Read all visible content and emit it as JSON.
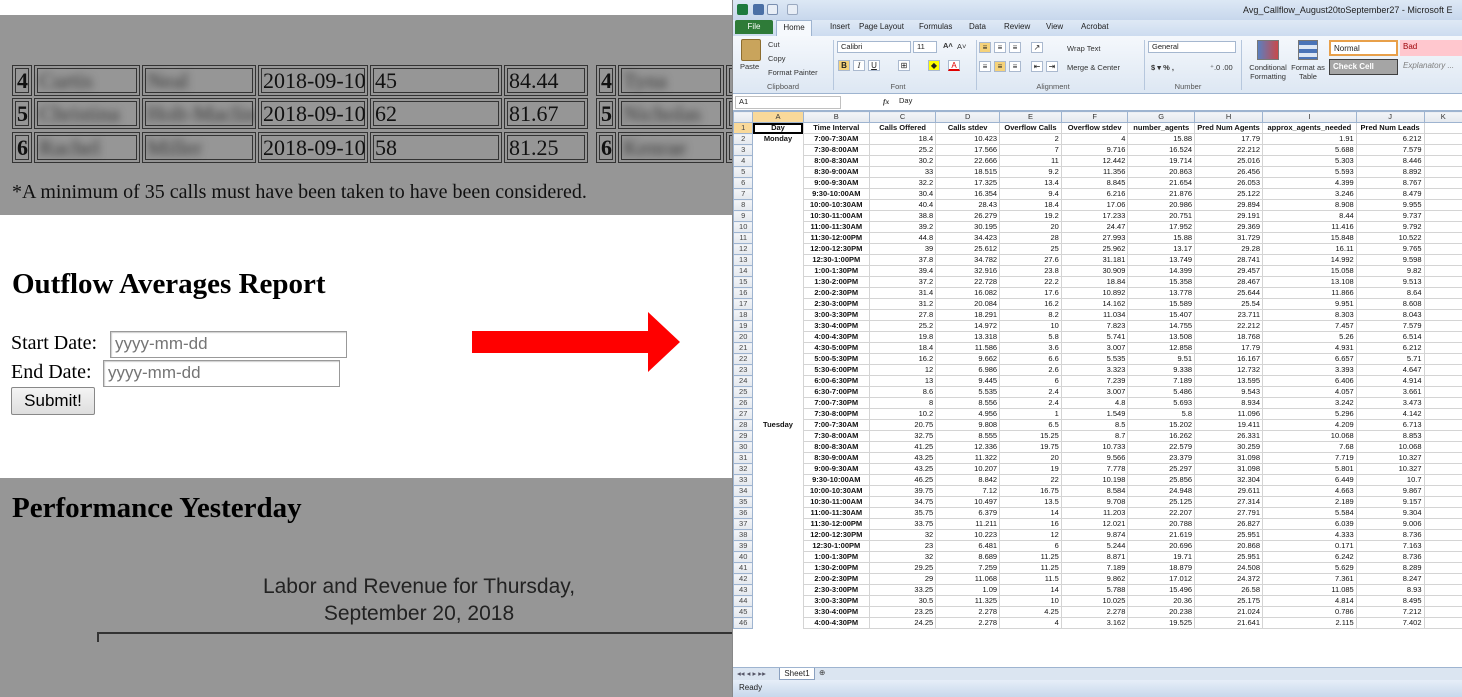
{
  "web": {
    "top_rows": [
      {
        "rank": "4",
        "first": "Curtis",
        "last": "Neal",
        "date": "2018-09-10",
        "calls": "45",
        "score": "84.44",
        "rank2": "4",
        "first2": "Tyna"
      },
      {
        "rank": "5",
        "first": "Christina",
        "last": "Holt-Maclin",
        "date": "2018-09-10",
        "calls": "62",
        "score": "81.67",
        "rank2": "5",
        "first2": "Nicholas"
      },
      {
        "rank": "6",
        "first": "Rachel",
        "last": "Miller",
        "date": "2018-09-10",
        "calls": "58",
        "score": "81.25",
        "rank2": "6",
        "first2": "Kenrae"
      }
    ],
    "note": "*A minimum of 35 calls must have been taken to have been considered.",
    "report_title": "Outflow Averages Report",
    "start_label": "Start Date:",
    "start_placeholder": "yyyy-mm-dd",
    "end_label": "End Date:",
    "end_placeholder": "yyyy-mm-dd",
    "submit_label": "Submit!",
    "perf_title": "Performance Yesterday",
    "labor_line1": "Labor and Revenue for Thursday,",
    "labor_line2": "September 20, 2018",
    "arrow_color": "#ff0000"
  },
  "excel": {
    "window_title": "Avg_Callflow_August20toSeptember27 - Microsoft E",
    "tabs": [
      "File",
      "Home",
      "Insert",
      "Page Layout",
      "Formulas",
      "Data",
      "Review",
      "View",
      "Acrobat"
    ],
    "clipboard": {
      "paste": "Paste",
      "cut": "Cut",
      "copy": "Copy",
      "format_painter": "Format Painter",
      "group": "Clipboard"
    },
    "font": {
      "name": "Calibri",
      "size": "11",
      "group": "Font"
    },
    "alignment": {
      "wrap": "Wrap Text",
      "merge": "Merge & Center",
      "group": "Alignment"
    },
    "number": {
      "format": "General",
      "group": "Number"
    },
    "styles": {
      "conditional": "Conditional Formatting",
      "format_table": "Format as Table",
      "normal": "Normal",
      "bad": "Bad",
      "check_cell": "Check Cell",
      "explanatory": "Explanatory ..."
    },
    "name_box": "A1",
    "formula": "Day",
    "col_letters": [
      "A",
      "B",
      "C",
      "D",
      "E",
      "F",
      "G",
      "H",
      "I",
      "J",
      "K"
    ],
    "headers": [
      "Day",
      "Time Interval",
      "Calls Offered",
      "Calls stdev",
      "Overflow Calls",
      "Overflow stdev",
      "number_agents",
      "Pred Num Agents",
      "approx_agents_needed",
      "Pred Num Leads"
    ],
    "rows": [
      [
        "Monday",
        "7:00-7:30AM",
        "18.4",
        "10.423",
        "2",
        "4",
        "15.88",
        "17.79",
        "1.91",
        "6.212"
      ],
      [
        "",
        "7:30-8:00AM",
        "25.2",
        "17.566",
        "7",
        "9.716",
        "16.524",
        "22.212",
        "5.688",
        "7.579"
      ],
      [
        "",
        "8:00-8:30AM",
        "30.2",
        "22.666",
        "11",
        "12.442",
        "19.714",
        "25.016",
        "5.303",
        "8.446"
      ],
      [
        "",
        "8:30-9:00AM",
        "33",
        "18.515",
        "9.2",
        "11.356",
        "20.863",
        "26.456",
        "5.593",
        "8.892"
      ],
      [
        "",
        "9:00-9:30AM",
        "32.2",
        "17.325",
        "13.4",
        "8.845",
        "21.654",
        "26.053",
        "4.399",
        "8.767"
      ],
      [
        "",
        "9:30-10:00AM",
        "30.4",
        "16.354",
        "9.4",
        "6.216",
        "21.876",
        "25.122",
        "3.246",
        "8.479"
      ],
      [
        "",
        "10:00-10:30AM",
        "40.4",
        "28.43",
        "18.4",
        "17.06",
        "20.986",
        "29.894",
        "8.908",
        "9.955"
      ],
      [
        "",
        "10:30-11:00AM",
        "38.8",
        "26.279",
        "19.2",
        "17.233",
        "20.751",
        "29.191",
        "8.44",
        "9.737"
      ],
      [
        "",
        "11:00-11:30AM",
        "39.2",
        "30.195",
        "20",
        "24.47",
        "17.952",
        "29.369",
        "11.416",
        "9.792"
      ],
      [
        "",
        "11:30-12:00PM",
        "44.8",
        "34.423",
        "28",
        "27.993",
        "15.88",
        "31.729",
        "15.848",
        "10.522"
      ],
      [
        "",
        "12:00-12:30PM",
        "39",
        "25.612",
        "25",
        "25.962",
        "13.17",
        "29.28",
        "16.11",
        "9.765"
      ],
      [
        "",
        "12:30-1:00PM",
        "37.8",
        "34.782",
        "27.6",
        "31.181",
        "13.749",
        "28.741",
        "14.992",
        "9.598"
      ],
      [
        "",
        "1:00-1:30PM",
        "39.4",
        "32.916",
        "23.8",
        "30.909",
        "14.399",
        "29.457",
        "15.058",
        "9.82"
      ],
      [
        "",
        "1:30-2:00PM",
        "37.2",
        "22.728",
        "22.2",
        "18.84",
        "15.358",
        "28.467",
        "13.108",
        "9.513"
      ],
      [
        "",
        "2:00-2:30PM",
        "31.4",
        "16.082",
        "17.6",
        "10.892",
        "13.778",
        "25.644",
        "11.866",
        "8.64"
      ],
      [
        "",
        "2:30-3:00PM",
        "31.2",
        "20.084",
        "16.2",
        "14.162",
        "15.589",
        "25.54",
        "9.951",
        "8.608"
      ],
      [
        "",
        "3:00-3:30PM",
        "27.8",
        "18.291",
        "8.2",
        "11.034",
        "15.407",
        "23.711",
        "8.303",
        "8.043"
      ],
      [
        "",
        "3:30-4:00PM",
        "25.2",
        "14.972",
        "10",
        "7.823",
        "14.755",
        "22.212",
        "7.457",
        "7.579"
      ],
      [
        "",
        "4:00-4:30PM",
        "19.8",
        "13.318",
        "5.8",
        "5.741",
        "13.508",
        "18.768",
        "5.26",
        "6.514"
      ],
      [
        "",
        "4:30-5:00PM",
        "18.4",
        "11.586",
        "3.6",
        "3.007",
        "12.858",
        "17.79",
        "4.931",
        "6.212"
      ],
      [
        "",
        "5:00-5:30PM",
        "16.2",
        "9.662",
        "6.6",
        "5.535",
        "9.51",
        "16.167",
        "6.657",
        "5.71"
      ],
      [
        "",
        "5:30-6:00PM",
        "12",
        "6.986",
        "2.6",
        "3.323",
        "9.338",
        "12.732",
        "3.393",
        "4.647"
      ],
      [
        "",
        "6:00-6:30PM",
        "13",
        "9.445",
        "6",
        "7.239",
        "7.189",
        "13.595",
        "6.406",
        "4.914"
      ],
      [
        "",
        "6:30-7:00PM",
        "8.6",
        "5.535",
        "2.4",
        "3.007",
        "5.486",
        "9.543",
        "4.057",
        "3.661"
      ],
      [
        "",
        "7:00-7:30PM",
        "8",
        "8.556",
        "2.4",
        "4.8",
        "5.693",
        "8.934",
        "3.242",
        "3.473"
      ],
      [
        "",
        "7:30-8:00PM",
        "10.2",
        "4.956",
        "1",
        "1.549",
        "5.8",
        "11.096",
        "5.296",
        "4.142"
      ],
      [
        "Tuesday",
        "7:00-7:30AM",
        "20.75",
        "9.808",
        "6.5",
        "8.5",
        "15.202",
        "19.411",
        "4.209",
        "6.713"
      ],
      [
        "",
        "7:30-8:00AM",
        "32.75",
        "8.555",
        "15.25",
        "8.7",
        "16.262",
        "26.331",
        "10.068",
        "8.853"
      ],
      [
        "",
        "8:00-8:30AM",
        "41.25",
        "12.336",
        "19.75",
        "10.733",
        "22.579",
        "30.259",
        "7.68",
        "10.068"
      ],
      [
        "",
        "8:30-9:00AM",
        "43.25",
        "11.322",
        "20",
        "9.566",
        "23.379",
        "31.098",
        "7.719",
        "10.327"
      ],
      [
        "",
        "9:00-9:30AM",
        "43.25",
        "10.207",
        "19",
        "7.778",
        "25.297",
        "31.098",
        "5.801",
        "10.327"
      ],
      [
        "",
        "9:30-10:00AM",
        "46.25",
        "8.842",
        "22",
        "10.198",
        "25.856",
        "32.304",
        "6.449",
        "10.7"
      ],
      [
        "",
        "10:00-10:30AM",
        "39.75",
        "7.12",
        "16.75",
        "8.584",
        "24.948",
        "29.611",
        "4.663",
        "9.867"
      ],
      [
        "",
        "10:30-11:00AM",
        "34.75",
        "10.497",
        "13.5",
        "9.708",
        "25.125",
        "27.314",
        "2.189",
        "9.157"
      ],
      [
        "",
        "11:00-11:30AM",
        "35.75",
        "6.379",
        "14",
        "11.203",
        "22.207",
        "27.791",
        "5.584",
        "9.304"
      ],
      [
        "",
        "11:30-12:00PM",
        "33.75",
        "11.211",
        "16",
        "12.021",
        "20.788",
        "26.827",
        "6.039",
        "9.006"
      ],
      [
        "",
        "12:00-12:30PM",
        "32",
        "10.223",
        "12",
        "9.874",
        "21.619",
        "25.951",
        "4.333",
        "8.736"
      ],
      [
        "",
        "12:30-1:00PM",
        "23",
        "6.481",
        "6",
        "5.244",
        "20.696",
        "20.868",
        "0.171",
        "7.163"
      ],
      [
        "",
        "1:00-1:30PM",
        "32",
        "8.689",
        "11.25",
        "8.871",
        "19.71",
        "25.951",
        "6.242",
        "8.736"
      ],
      [
        "",
        "1:30-2:00PM",
        "29.25",
        "7.259",
        "11.25",
        "7.189",
        "18.879",
        "24.508",
        "5.629",
        "8.289"
      ],
      [
        "",
        "2:00-2:30PM",
        "29",
        "11.068",
        "11.5",
        "9.862",
        "17.012",
        "24.372",
        "7.361",
        "8.247"
      ],
      [
        "",
        "2:30-3:00PM",
        "33.25",
        "1.09",
        "14",
        "5.788",
        "15.496",
        "26.58",
        "11.085",
        "8.93"
      ],
      [
        "",
        "3:00-3:30PM",
        "30.5",
        "11.325",
        "10",
        "10.025",
        "20.36",
        "25.175",
        "4.814",
        "8.495"
      ],
      [
        "",
        "3:30-4:00PM",
        "23.25",
        "2.278",
        "4.25",
        "2.278",
        "20.238",
        "21.024",
        "0.786",
        "7.212"
      ],
      [
        "",
        "4:00-4:30PM",
        "24.25",
        "2.278",
        "4",
        "3.162",
        "19.525",
        "21.641",
        "2.115",
        "7.402"
      ]
    ],
    "sheet_tab": "Sheet1",
    "status": "Ready"
  }
}
